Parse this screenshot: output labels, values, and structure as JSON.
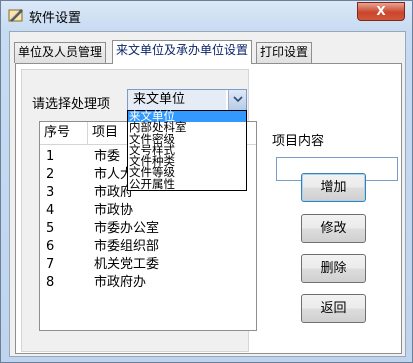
{
  "window": {
    "title": "软件设置",
    "close_label": "X"
  },
  "tabs": [
    {
      "label": "单位及人员管理"
    },
    {
      "label": "来文单位及承办单位设置"
    },
    {
      "label": "打印设置"
    }
  ],
  "select": {
    "label": "请选择处理项",
    "value": "来文单位",
    "options": [
      "来文单位",
      "内部处科室",
      "文件密级",
      "文号样式",
      "文件种类",
      "文件等级",
      "公开属性"
    ]
  },
  "list": {
    "headers": [
      "序号",
      "项目"
    ],
    "rows": [
      {
        "num": "1",
        "name": "市委"
      },
      {
        "num": "2",
        "name": "市人大"
      },
      {
        "num": "3",
        "name": "市政府"
      },
      {
        "num": "4",
        "name": "市政协"
      },
      {
        "num": "5",
        "name": "市委办公室"
      },
      {
        "num": "6",
        "name": "市委组织部"
      },
      {
        "num": "7",
        "name": "机关党工委"
      },
      {
        "num": "8",
        "name": "市政府办"
      }
    ]
  },
  "content": {
    "label": "项目内容",
    "value": ""
  },
  "buttons": {
    "add": "增加",
    "edit": "修改",
    "delete": "删除",
    "back": "返回"
  }
}
